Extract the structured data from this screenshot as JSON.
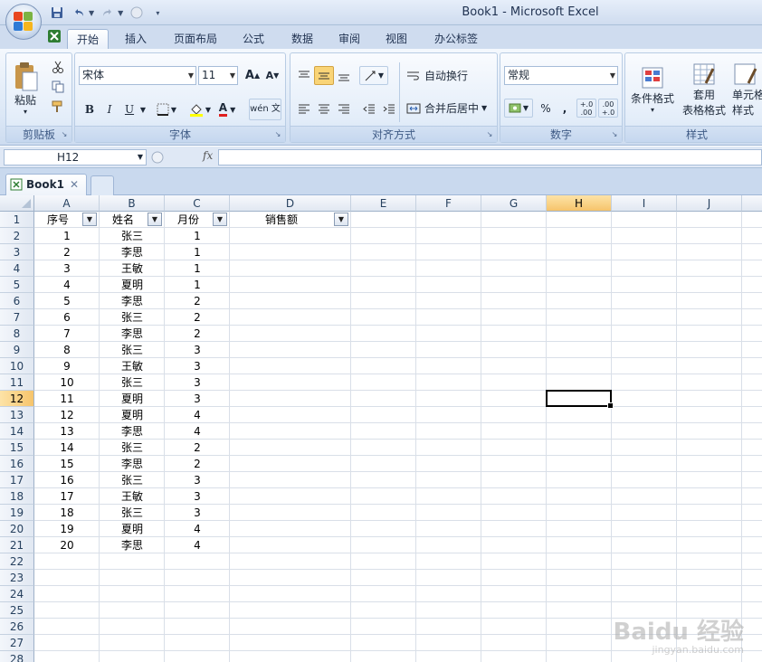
{
  "window": {
    "title": "Book1 - Microsoft Excel"
  },
  "ribbon": {
    "tabs": [
      "开始",
      "插入",
      "页面布局",
      "公式",
      "数据",
      "审阅",
      "视图",
      "办公标签"
    ],
    "active_tab": "开始",
    "clipboard": {
      "paste_label": "粘贴",
      "group_label": "剪贴板"
    },
    "font": {
      "name": "宋体",
      "size": "11",
      "grow": "A",
      "shrink": "A",
      "bold": "B",
      "italic": "I",
      "underline": "U",
      "font_color": "A",
      "phonetic": "wén 文",
      "group_label": "字体"
    },
    "alignment": {
      "wrap_text": "自动换行",
      "merge_center": "合并后居中",
      "group_label": "对齐方式"
    },
    "number": {
      "format": "常规",
      "percent": "%",
      "comma": ",",
      "increase_decimal": "+.0 .00",
      "decrease_decimal": ".00 +.0",
      "group_label": "数字"
    },
    "styles": {
      "conditional": "条件格式",
      "table_line1": "套用",
      "table_line2": "表格格式",
      "cell_line1": "单元格",
      "cell_line2": "样式",
      "group_label": "样式"
    }
  },
  "formula_bar": {
    "name_box": "H12",
    "fx": "fx",
    "formula": ""
  },
  "workbook_tab": {
    "name": "Book1",
    "close": "✕"
  },
  "sheet": {
    "columns": [
      "A",
      "B",
      "C",
      "D",
      "E",
      "F",
      "G",
      "H",
      "I",
      "J"
    ],
    "selected_column": "H",
    "selected_row": 12,
    "active_cell": "H12",
    "row_numbers": [
      1,
      2,
      3,
      4,
      5,
      6,
      7,
      8,
      9,
      10,
      11,
      12,
      13,
      14,
      15,
      16,
      17,
      18,
      19,
      20,
      21,
      22,
      23,
      24,
      25,
      26,
      27,
      28
    ],
    "headers": [
      "序号",
      "姓名",
      "月份",
      "销售额"
    ],
    "rows": [
      [
        "1",
        "张三",
        "1"
      ],
      [
        "2",
        "李思",
        "1"
      ],
      [
        "3",
        "王敏",
        "1"
      ],
      [
        "4",
        "夏明",
        "1"
      ],
      [
        "5",
        "李思",
        "2"
      ],
      [
        "6",
        "张三",
        "2"
      ],
      [
        "7",
        "李思",
        "2"
      ],
      [
        "8",
        "张三",
        "3"
      ],
      [
        "9",
        "王敏",
        "3"
      ],
      [
        "10",
        "张三",
        "3"
      ],
      [
        "11",
        "夏明",
        "3"
      ],
      [
        "12",
        "夏明",
        "4"
      ],
      [
        "13",
        "李思",
        "4"
      ],
      [
        "14",
        "张三",
        "2"
      ],
      [
        "15",
        "李思",
        "2"
      ],
      [
        "16",
        "张三",
        "3"
      ],
      [
        "17",
        "王敏",
        "3"
      ],
      [
        "18",
        "张三",
        "3"
      ],
      [
        "19",
        "夏明",
        "4"
      ],
      [
        "20",
        "李思",
        "4"
      ]
    ]
  },
  "watermark": {
    "main": "Baidu 经验",
    "sub": "jingyan.baidu.com"
  }
}
